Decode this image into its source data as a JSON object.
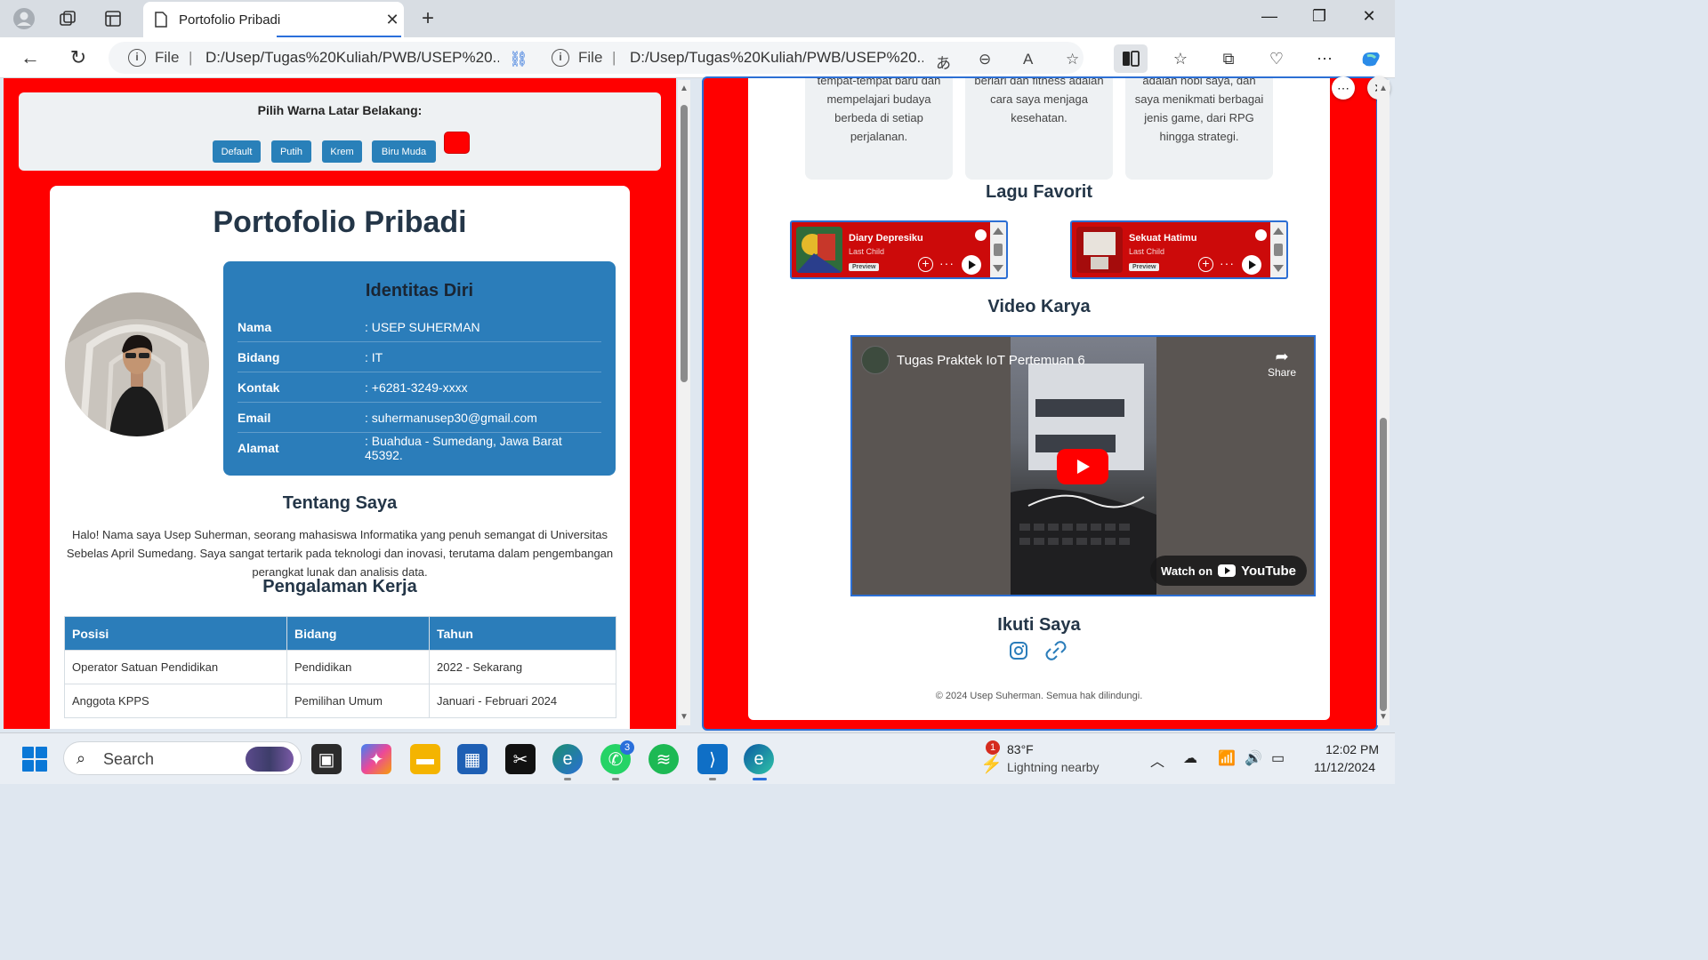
{
  "browser": {
    "tab_title": "Portofolio Pribadi",
    "url_scheme_left": "File",
    "url_left": "D:/Usep/Tugas%20Kuliah/PWB/USEP%20...",
    "url_scheme_right": "File",
    "url_right": "D:/Usep/Tugas%20Kuliah/PWB/USEP%20...",
    "accent": "#2c6fd4"
  },
  "left_page": {
    "background_color": "#ff0000",
    "color_picker": {
      "title": "Pilih Warna Latar Belakang:",
      "buttons": [
        "Default",
        "Putih",
        "Krem",
        "Biru Muda"
      ],
      "selected_swatch": "#ff0000"
    },
    "title": "Portofolio Pribadi",
    "identity": {
      "heading": "Identitas Diri",
      "rows": [
        {
          "key": "Nama",
          "value": ": USEP SUHERMAN"
        },
        {
          "key": "Bidang",
          "value": ": IT"
        },
        {
          "key": "Kontak",
          "value": ": +6281-3249-xxxx"
        },
        {
          "key": "Email",
          "value": ": suhermanusep30@gmail.com"
        },
        {
          "key": "Alamat",
          "value": ": Buahdua - Sumedang, Jawa Barat 45392."
        }
      ]
    },
    "about": {
      "heading": "Tentang Saya",
      "text": "Halo! Nama saya Usep Suherman, seorang mahasiswa Informatika yang penuh semangat di Universitas Sebelas April Sumedang. Saya sangat tertarik pada teknologi dan inovasi, terutama dalam pengembangan perangkat lunak dan analisis data."
    },
    "experience": {
      "heading": "Pengalaman Kerja",
      "columns": [
        "Posisi",
        "Bidang",
        "Tahun"
      ],
      "rows": [
        [
          "Operator Satuan Pendidikan",
          "Pendidikan",
          "2022 - Sekarang"
        ],
        [
          "Anggota KPPS",
          "Pemilihan Umum",
          "Januari - Februari 2024"
        ]
      ]
    }
  },
  "right_page": {
    "hobbies": [
      {
        "text": "tempat-tempat baru dan mempelajari budaya berbeda di setiap perjalanan."
      },
      {
        "text": "berlari dan fitness adalah cara saya menjaga kesehatan."
      },
      {
        "text": "adalah hobi saya, dan saya menikmati berbagai jenis game, dari RPG hingga strategi."
      }
    ],
    "songs_heading": "Lagu Favorit",
    "songs": [
      {
        "title": "Diary Depresiku",
        "artist": "Last Child",
        "preview": "Preview"
      },
      {
        "title": "Sekuat Hatimu",
        "artist": "Last Child",
        "preview": "Preview"
      }
    ],
    "video_heading": "Video Karya",
    "video": {
      "title": "Tugas Praktek IoT Pertemuan 6",
      "share": "Share",
      "watch_on": "Watch on",
      "yt_brand": "YouTube"
    },
    "follow_heading": "Ikuti Saya",
    "footer": "© 2024 Usep Suherman. Semua hak dilindungi."
  },
  "taskbar": {
    "search_placeholder": "Search",
    "weather_temp": "83°F",
    "weather_desc": "Lightning nearby",
    "weather_alerts": "1",
    "whatsapp_badge": "3",
    "time": "12:02 PM",
    "date": "11/12/2024"
  }
}
